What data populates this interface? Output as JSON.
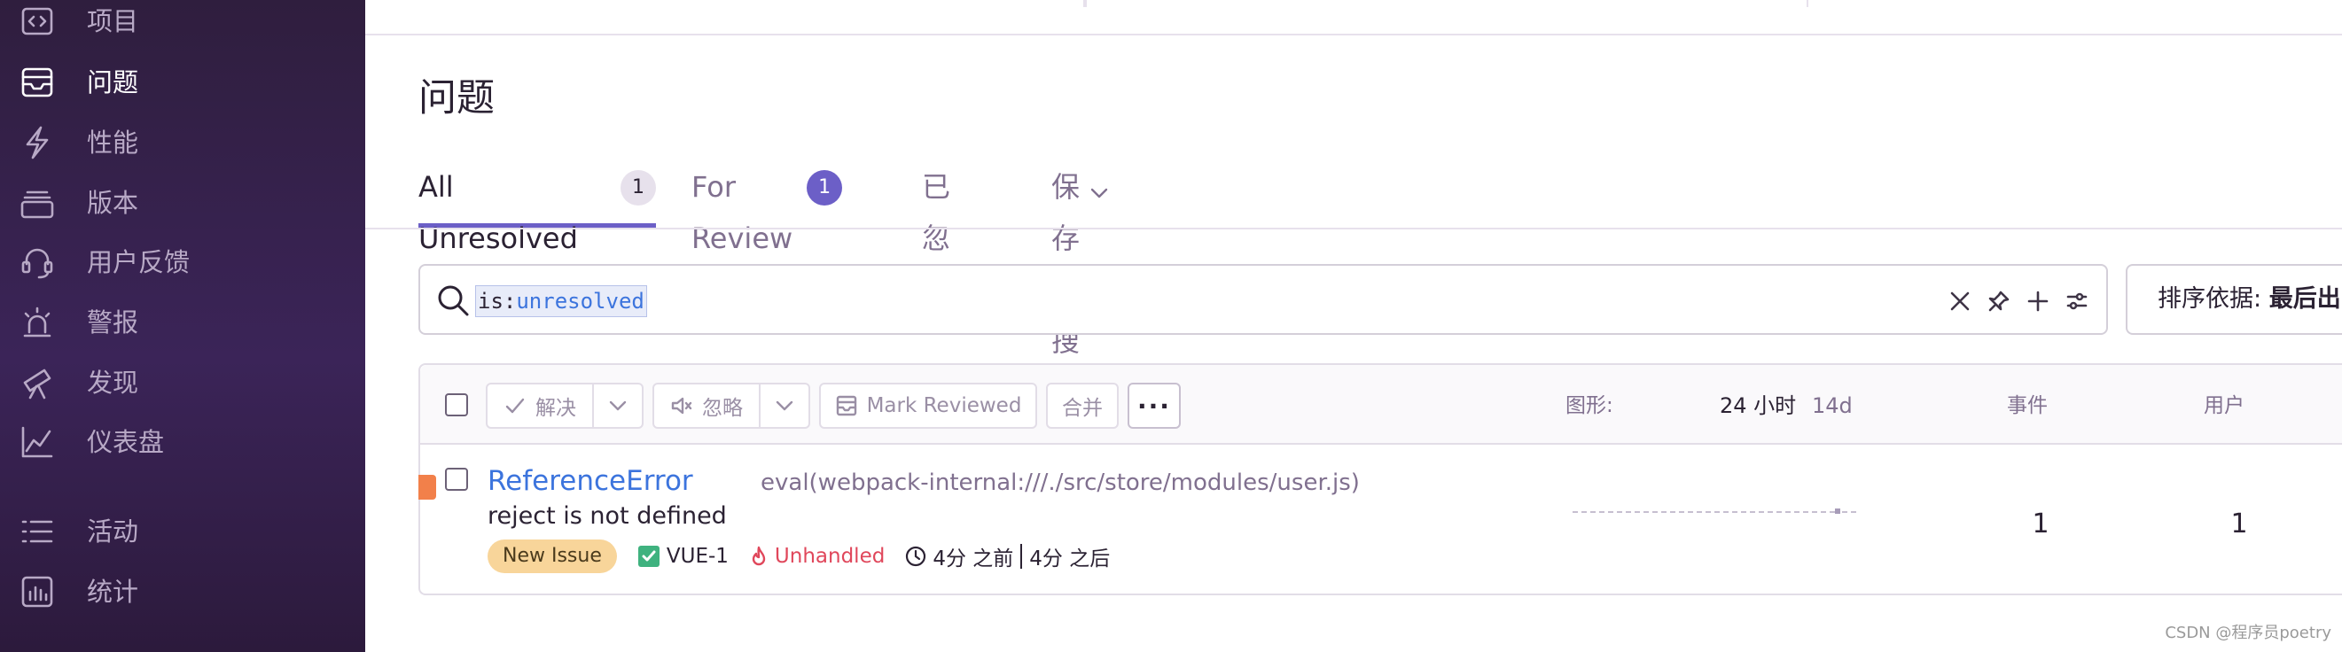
{
  "sidebar": {
    "items": [
      {
        "label": "项目",
        "icon": "project-icon",
        "active": false
      },
      {
        "label": "问题",
        "icon": "issues-icon",
        "active": true
      },
      {
        "label": "性能",
        "icon": "lightning-icon",
        "active": false
      },
      {
        "label": "版本",
        "icon": "releases-icon",
        "active": false
      },
      {
        "label": "用户反馈",
        "icon": "headset-icon",
        "active": false
      },
      {
        "label": "警报",
        "icon": "siren-icon",
        "active": false
      },
      {
        "label": "发现",
        "icon": "telescope-icon",
        "active": false
      },
      {
        "label": "仪表盘",
        "icon": "chart-line-icon",
        "active": false
      },
      {
        "label": "活动",
        "icon": "list-icon",
        "active": false
      },
      {
        "label": "统计",
        "icon": "bar-stats-icon",
        "active": false
      }
    ]
  },
  "page": {
    "title": "问题"
  },
  "tabs": [
    {
      "label": "All Unresolved",
      "count": "1",
      "active": true
    },
    {
      "label": "For Review",
      "count": "1",
      "active": false
    },
    {
      "label": "已忽略"
    },
    {
      "label": "保存的搜索"
    }
  ],
  "search": {
    "query_key": "is:",
    "query_value": "unresolved"
  },
  "sort": {
    "label": "排序依据:",
    "value": "最后出"
  },
  "toolbar": {
    "resolve": "解决",
    "ignore": "忽略",
    "mark_reviewed": "Mark Reviewed",
    "merge": "合并",
    "more": "···",
    "graph_label": "图形:",
    "period_24h": "24 小时",
    "period_14d": "14d",
    "events_header": "事件",
    "users_header": "用户"
  },
  "issue": {
    "title": "ReferenceError",
    "location": "eval(webpack-internal:///./src/store/modules/user.js)",
    "message": "reject is not defined",
    "badge": "New Issue",
    "project": "VUE-1",
    "handled": "Unhandled",
    "first_seen": "4分 之前",
    "last_seen": "4分 之后",
    "events": "1",
    "users": "1"
  },
  "colors": {
    "accent": "#6c5fc7",
    "link": "#3c74dd",
    "level_warning": "#f2804a",
    "unhandled": "#e0475b",
    "sidebar_bg": "#3b2458"
  },
  "watermark": "CSDN @程序员poetry"
}
